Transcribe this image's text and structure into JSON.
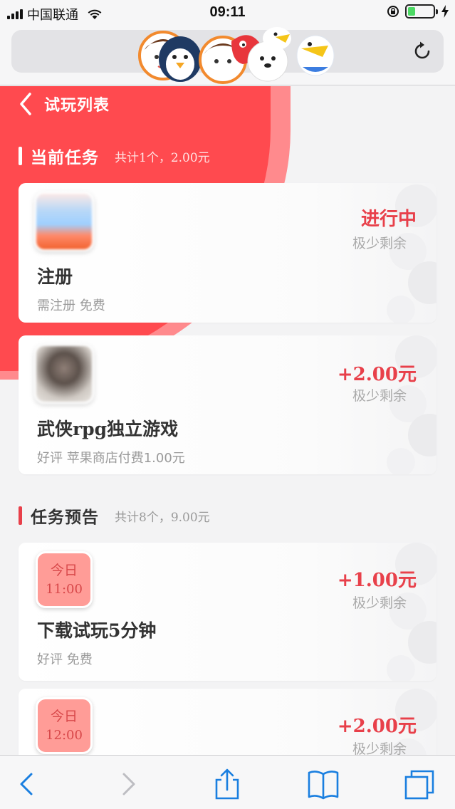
{
  "status_bar": {
    "carrier": "中国联通",
    "time": "09:11",
    "battery_level": 0.3
  },
  "nav": {
    "title": "试玩列表"
  },
  "current_section": {
    "title": "当前任务",
    "summary": "共计1个，2.00元",
    "accent_color": "#ffffff"
  },
  "current_tasks": [
    {
      "name": "注册",
      "desc": "需注册 免费",
      "reward": "进行中",
      "hint": "极少剩余"
    },
    {
      "name": "武侠rpg独立游戏",
      "desc": "好评 苹果商店付费1.00元",
      "reward": "+2.00元",
      "hint": "极少剩余"
    }
  ],
  "preview_section": {
    "title": "任务预告",
    "summary": "共计8个，9.00元",
    "accent_color": "#e8404a"
  },
  "preview_tasks": [
    {
      "day": "今日",
      "time": "11:00",
      "name": "下载试玩5分钟",
      "desc": "好评 免费",
      "reward": "+1.00元",
      "hint": "极少剩余"
    },
    {
      "day": "今日",
      "time": "12:00",
      "name": "",
      "desc": "",
      "reward": "+2.00元",
      "hint": "极少剩余"
    }
  ],
  "colors": {
    "brand_red": "#ff4a4f",
    "reward_red": "#e8404a",
    "safari_blue": "#1a7fe0"
  }
}
